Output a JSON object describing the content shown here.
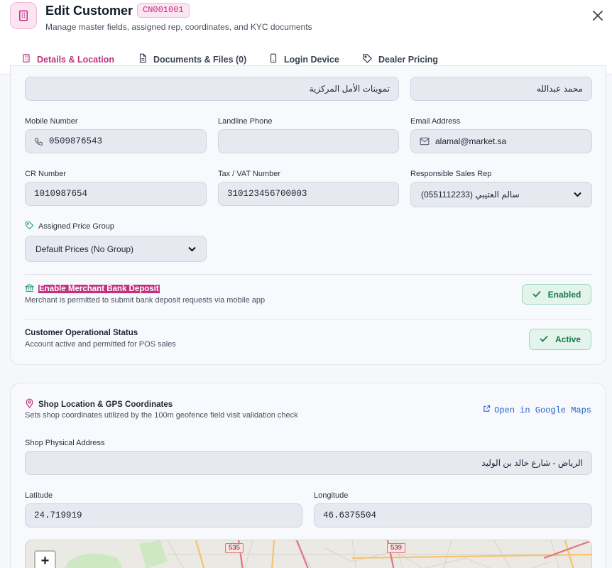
{
  "header": {
    "title": "Edit Customer",
    "code": "CN001001",
    "subtitle": "Manage master fields, assigned rep, coordinates, and KYC documents"
  },
  "tabs": [
    {
      "label": "Details & Location",
      "icon": "building-icon",
      "active": true
    },
    {
      "label": "Documents & Files (0)",
      "icon": "document-icon",
      "active": false
    },
    {
      "label": "Login Device",
      "icon": "phone-icon",
      "active": false
    },
    {
      "label": "Dealer Pricing",
      "icon": "tag-icon",
      "active": false
    }
  ],
  "details": {
    "store_name_value": "تموينات الأمل المركزية",
    "owner_name_value": "محمد عبدالله",
    "mobile": {
      "label": "Mobile Number",
      "value": "0509876543"
    },
    "landline": {
      "label": "Landline Phone",
      "value": ""
    },
    "email": {
      "label": "Email Address",
      "value": "alamal@market.sa"
    },
    "cr": {
      "label": "CR Number",
      "value": "1010987654"
    },
    "vat": {
      "label": "Tax / VAT Number",
      "value": "310123456700003"
    },
    "rep": {
      "label": "Responsible Sales Rep",
      "value": "سالم العتيبي (0551112233)"
    },
    "price_group": {
      "label": "Assigned Price Group",
      "value": "Default Prices (No Group)"
    }
  },
  "bank_deposit": {
    "title": "Enable Merchant Bank Deposit",
    "subtitle": "Merchant is permitted to submit bank deposit requests via mobile app",
    "status": "Enabled"
  },
  "operational": {
    "title": "Customer Operational Status",
    "subtitle": "Account active and permitted for POS sales",
    "status": "Active"
  },
  "location": {
    "title": "Shop Location & GPS Coordinates",
    "subtitle": "Sets shop coordinates utilized by the 100m geofence field visit validation check",
    "maps_link": "Open in Google Maps",
    "address": {
      "label": "Shop Physical Address",
      "value": "الرياض - شارع خالد بن الوليد"
    },
    "latitude": {
      "label": "Latitude",
      "value": "24.719919"
    },
    "longitude": {
      "label": "Longitude",
      "value": "46.6375504"
    }
  },
  "map": {
    "zoom_in": "+",
    "road_labels": [
      "535",
      "539"
    ]
  },
  "colors": {
    "accent": "#c2307f",
    "success": "#1a7a4d",
    "link": "#2563c9"
  }
}
